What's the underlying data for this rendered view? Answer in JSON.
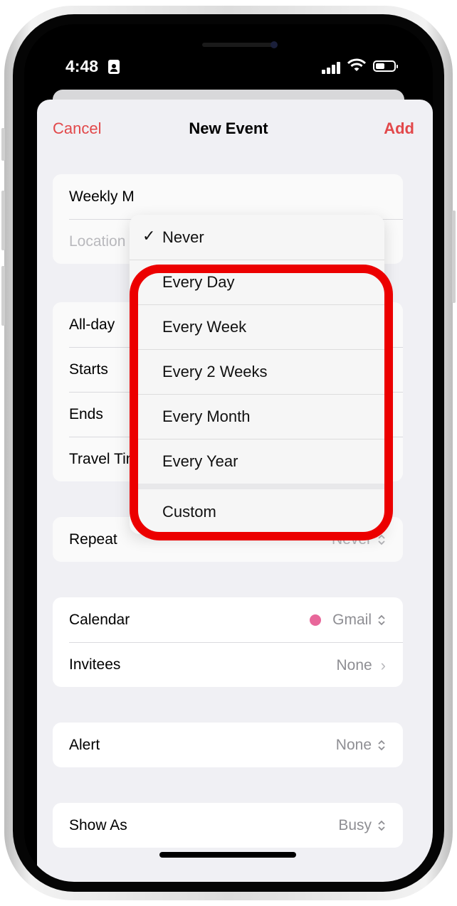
{
  "status_bar": {
    "time": "4:48",
    "icons": [
      "person-badge-icon",
      "signal-icon",
      "wifi-icon",
      "battery-icon"
    ]
  },
  "navbar": {
    "cancel_label": "Cancel",
    "title": "New Event",
    "add_label": "Add"
  },
  "title_group": {
    "title_value": "Weekly M",
    "location_placeholder": "Location"
  },
  "time_group": {
    "rows": [
      {
        "label": "All-day"
      },
      {
        "label": "Starts"
      },
      {
        "label": "Ends"
      },
      {
        "label": "Travel Time"
      }
    ]
  },
  "repeat_menu": {
    "selected": "Never",
    "options": [
      "Never",
      "Every Day",
      "Every Week",
      "Every 2 Weeks",
      "Every Month",
      "Every Year"
    ],
    "custom_label": "Custom",
    "checkmark": "✓"
  },
  "repeat_row": {
    "label": "Repeat",
    "value": "Never"
  },
  "calendar_group": {
    "calendar": {
      "label": "Calendar",
      "value": "Gmail",
      "color": "#e8679a"
    },
    "invitees": {
      "label": "Invitees",
      "value": "None",
      "chevron": "›"
    }
  },
  "alert_row": {
    "label": "Alert",
    "value": "None"
  },
  "show_as_row": {
    "label": "Show As",
    "value": "Busy"
  },
  "colors": {
    "accent": "#e2484a",
    "highlight": "#ec0000"
  }
}
